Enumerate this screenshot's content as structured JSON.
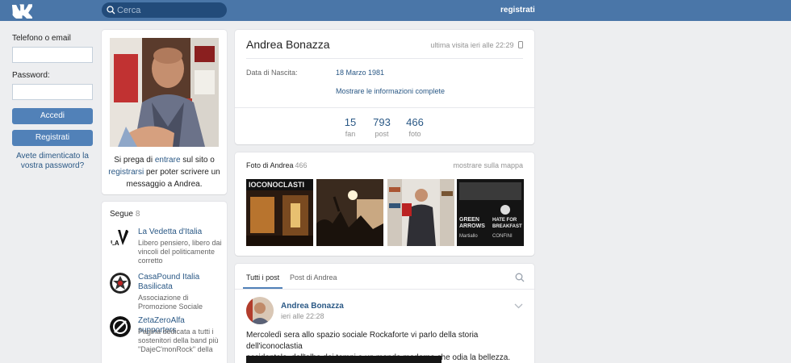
{
  "topbar": {
    "logo_icon": "vk-logo-icon",
    "search_placeholder": "Cerca",
    "register_label": "registrati",
    "colors": {
      "bar": "#4a76a8",
      "search_bg": "#224b7a"
    }
  },
  "login": {
    "phone_label": "Telefono o email",
    "password_label": "Password:",
    "login_button": "Accedi",
    "register_button": "Registrati",
    "forgot_line1": "Avete dimenticato la",
    "forgot_line2": "vostra password?"
  },
  "profile_photo": {
    "invite_pre": "Si prega di ",
    "invite_link1": "entrare",
    "invite_mid": " sul sito o",
    "invite_link2": "registrarsi",
    "invite_post": " per poter scrivere un",
    "invite_end": "messaggio a Andrea."
  },
  "following": {
    "title": "Segue",
    "count": "8",
    "items": [
      {
        "name": "La Vedetta d'Italia",
        "desc_lines": [
          "Libero pensiero, libero dai",
          "vincoli del politicamente",
          "corretto"
        ],
        "icon": "la-vedetta-logo-icon"
      },
      {
        "name_lines": [
          "CasaPound Italia",
          "Basilicata"
        ],
        "desc_lines": [
          "Associazione di",
          "Promozione Sociale"
        ],
        "icon": "casapound-logo-icon"
      },
      {
        "name": "ZetaZeroAlfa supporters",
        "desc_lines": [
          "Pagina dedicata a tutti i",
          "sostenitori della band più",
          "\"DajeC'monRock\" della"
        ],
        "icon": "zetazeroalfa-logo-icon"
      }
    ]
  },
  "profile": {
    "name": "Andrea Bonazza",
    "last_seen": "ultima visita ieri alle 22:29",
    "last_seen_icon": "mobile-phone-icon",
    "birth_label": "Data di Nascita:",
    "birth_value": "18 Marzo 1981",
    "more_info": "Mostrare le informazioni complete",
    "counters": [
      {
        "value": "15",
        "label": "fan"
      },
      {
        "value": "793",
        "label": "post"
      },
      {
        "value": "466",
        "label": "foto"
      }
    ]
  },
  "photos": {
    "title": "Foto di Andrea",
    "count": "466",
    "map_link": "mostrare sulla mappa",
    "thumbs": [
      {
        "text_lines": [
          "IOCONOCLASTI"
        ]
      },
      {
        "text_lines": []
      },
      {
        "text_lines": []
      },
      {
        "text_lines": [
          "GREEN",
          "ARROWS",
          "HATE FOR",
          "BREAKFAST",
          "Martiallo",
          "CONFINI"
        ]
      }
    ]
  },
  "wall": {
    "tab_all": "Tutti i post",
    "tab_own": "Post di Andrea",
    "search_icon": "search-icon",
    "post": {
      "author": "Andrea Bonazza",
      "time": "ieri alle 22:28",
      "text_line1": "Mercoledì sera allo spazio sociale Rockaforte vi parlo della storia dell'iconoclastia",
      "text_line2": "occidentale, dall'alba dei tempi a un mondo moderno che odia la bellezza."
    }
  },
  "colors": {
    "link": "#2a5885",
    "button": "#5181b8",
    "page_bg": "#edeef0"
  }
}
